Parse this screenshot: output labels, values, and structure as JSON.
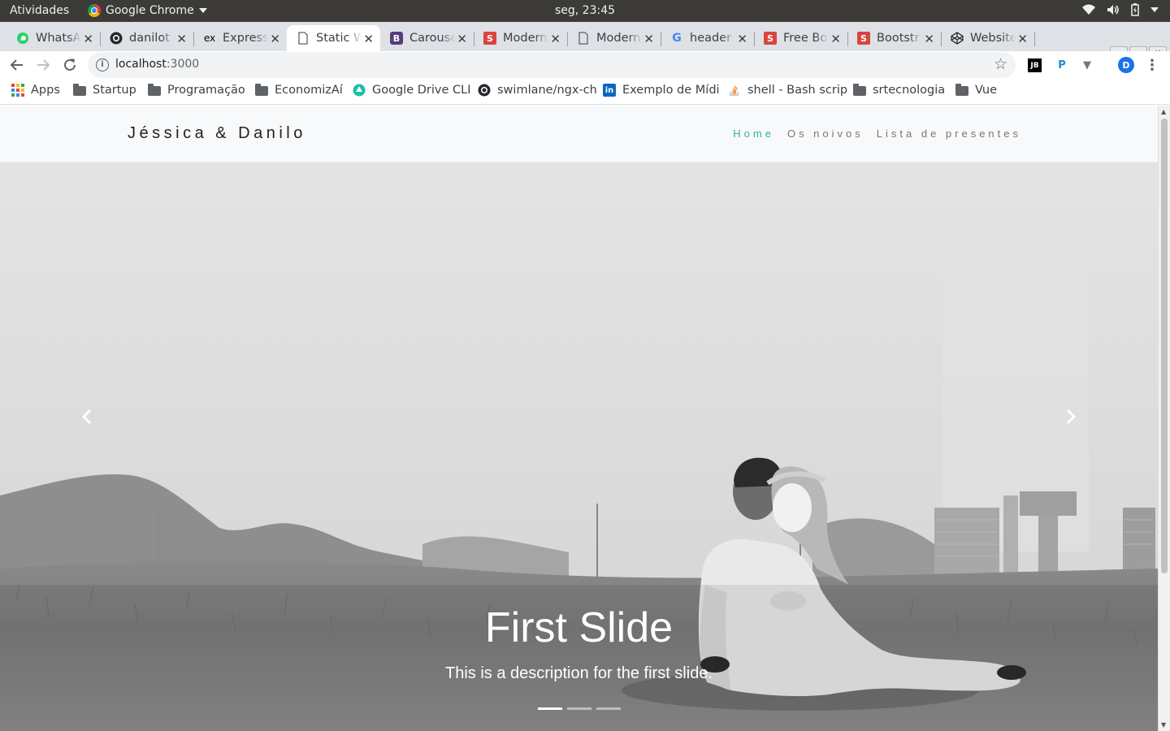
{
  "os": {
    "activities": "Atividades",
    "app_name": "Google Chrome",
    "clock": "seg, 23:45",
    "tray_icons": [
      "wifi-icon",
      "volume-icon",
      "battery-icon",
      "tray-menu-icon"
    ]
  },
  "tabs": [
    {
      "title": "WhatsApp",
      "icon": "whatsapp",
      "color": "#25d366"
    },
    {
      "title": "danilot",
      "icon": "github",
      "color": "#24292e"
    },
    {
      "title": "Express",
      "icon": "express",
      "color": "#000000"
    },
    {
      "title": "Static W",
      "icon": "document",
      "color": "#5f6368",
      "active": true
    },
    {
      "title": "Carousel",
      "icon": "bootstrap",
      "color": "#563d7c"
    },
    {
      "title": "Modern",
      "icon": "s-logo",
      "color": "#d9453d"
    },
    {
      "title": "Modern",
      "icon": "document",
      "color": "#5f6368"
    },
    {
      "title": "header",
      "icon": "google",
      "color": "#4285f4"
    },
    {
      "title": "Free Bo",
      "icon": "s-logo",
      "color": "#d9453d"
    },
    {
      "title": "Bootstr",
      "icon": "s-logo",
      "color": "#d9453d"
    },
    {
      "title": "Website",
      "icon": "codepen",
      "color": "#202124"
    }
  ],
  "omnibox": {
    "host": "localhost",
    "port": ":3000"
  },
  "bookmarks": [
    {
      "label": "Apps",
      "icon": "apps"
    },
    {
      "label": "Startup",
      "icon": "folder"
    },
    {
      "label": "Programação",
      "icon": "folder"
    },
    {
      "label": "EconomizAí",
      "icon": "folder"
    },
    {
      "label": "Google Drive CLI",
      "icon": "drive"
    },
    {
      "label": "swimlane/ngx-ch",
      "icon": "github"
    },
    {
      "label": "Exemplo de Mídi",
      "icon": "linkedin"
    },
    {
      "label": "shell - Bash scrip",
      "icon": "stackoverflow"
    },
    {
      "label": "srtecnologia",
      "icon": "folder"
    },
    {
      "label": "Vue",
      "icon": "folder"
    }
  ],
  "site": {
    "brand": "Jéssica & Danilo",
    "nav": [
      {
        "label": "Home",
        "active": true
      },
      {
        "label": "Os noivos",
        "active": false
      },
      {
        "label": "Lista de presentes",
        "active": false
      }
    ],
    "accent": "#2bb59a",
    "carousel": {
      "title": "First Slide",
      "description": "This is a description for the first slide.",
      "slide_count": 3,
      "active_index": 0,
      "prev_icon": "chevron-left-icon",
      "next_icon": "chevron-right-icon"
    }
  }
}
